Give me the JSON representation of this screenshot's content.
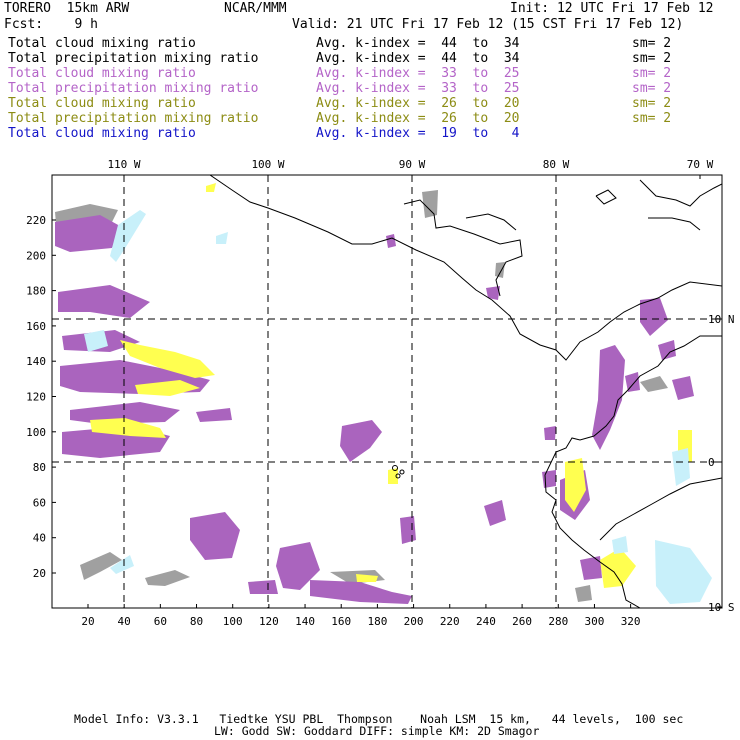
{
  "header": {
    "title": "TORERO  15km ARW",
    "org": "NCAR/MMM",
    "init": "Init: 12 UTC Fri 17 Feb 12",
    "fcst": "Fcst:    9 h",
    "valid": "Valid: 21 UTC Fri 17 Feb 12 (15 CST Fri 17 Feb 12)"
  },
  "legend": [
    {
      "field": "Total cloud mixing ratio",
      "kindex": "Avg. k-index =  44  to  34",
      "sm": "sm= 2",
      "color": "#000000"
    },
    {
      "field": "Total precipitation mixing ratio",
      "kindex": "Avg. k-index =  44  to  34",
      "sm": "sm= 2",
      "color": "#000000"
    },
    {
      "field": "Total cloud mixing ratio",
      "kindex": "Avg. k-index =  33  to  25",
      "sm": "sm= 2",
      "color": "#b464c8"
    },
    {
      "field": "Total precipitation mixing ratio",
      "kindex": "Avg. k-index =  33  to  25",
      "sm": "sm= 2",
      "color": "#b464c8"
    },
    {
      "field": "Total cloud mixing ratio",
      "kindex": "Avg. k-index =  26  to  20",
      "sm": "sm= 2",
      "color": "#8c8c14"
    },
    {
      "field": "Total precipitation mixing ratio",
      "kindex": "Avg. k-index =  26  to  20",
      "sm": "sm= 2",
      "color": "#8c8c14"
    },
    {
      "field": "Total cloud mixing ratio",
      "kindex": "Avg. k-index =  19  to   4",
      "sm": "",
      "color": "#1414c8"
    }
  ],
  "map": {
    "lon_labels": [
      "110 W",
      "100 W",
      "90 W",
      "80 W",
      "70 W"
    ],
    "lat_labels": [
      "10 N",
      "0",
      "10 S"
    ],
    "x_ticks": [
      "20",
      "40",
      "60",
      "80",
      "100",
      "120",
      "140",
      "160",
      "180",
      "200",
      "220",
      "240",
      "260",
      "280",
      "300",
      "320"
    ],
    "y_ticks": [
      "20",
      "40",
      "60",
      "80",
      "100",
      "120",
      "140",
      "160",
      "180",
      "200",
      "220"
    ],
    "colors": {
      "gray": "#a0a0a0",
      "purple": "#aa64be",
      "yellow": "#ffff50",
      "cyan": "#c8f0fa"
    }
  },
  "footer": {
    "line1": "Model Info: V3.3.1   Tiedtke YSU PBL  Thompson    Noah LSM  15 km,   44 levels,  100 sec",
    "line2": "LW: Godd SW: Goddard DIFF: simple KM: 2D Smagor"
  }
}
